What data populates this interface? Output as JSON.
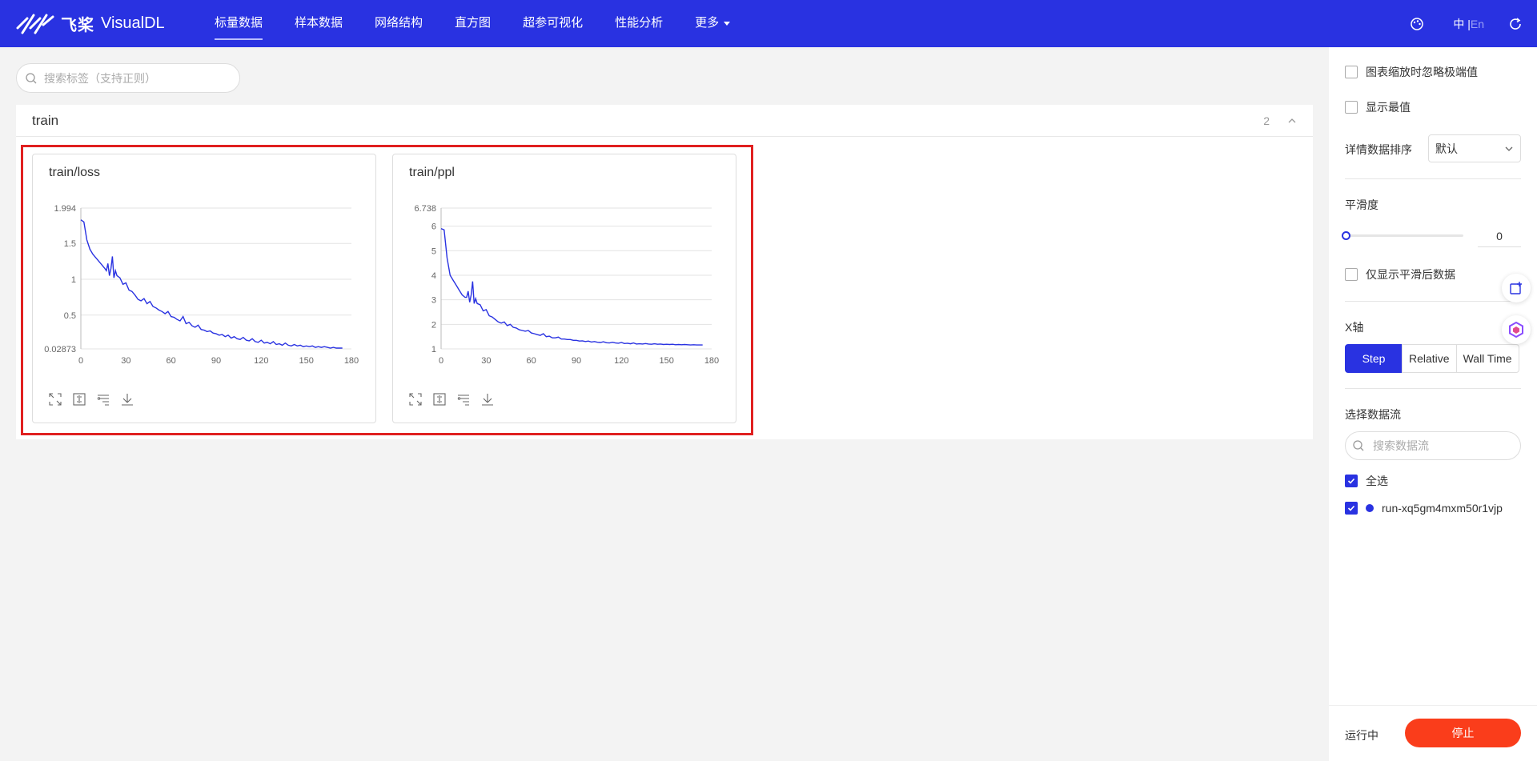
{
  "brand": {
    "cn": "飞桨",
    "en": "VisualDL"
  },
  "nav": {
    "items": [
      {
        "label": "标量数据"
      },
      {
        "label": "样本数据"
      },
      {
        "label": "网络结构"
      },
      {
        "label": "直方图"
      },
      {
        "label": "超参可视化"
      },
      {
        "label": "性能分析"
      },
      {
        "label": "更多"
      }
    ],
    "lang_cn": "中",
    "lang_sep": "|",
    "lang_en": "En"
  },
  "search": {
    "placeholder": "搜索标签（支持正则）"
  },
  "group": {
    "title": "train",
    "count": "2"
  },
  "cards": [
    {
      "title": "train/loss"
    },
    {
      "title": "train/ppl"
    }
  ],
  "chart_data": [
    {
      "type": "line",
      "title": "train/loss",
      "xlim": [
        0,
        180
      ],
      "ylim": [
        0.02873,
        1.994
      ],
      "xticks": [
        "0",
        "30",
        "60",
        "90",
        "120",
        "150",
        "180"
      ],
      "yticks": [
        "0.02873",
        "0.5",
        "1",
        "1.5",
        "1.994"
      ],
      "color": "#2932e1",
      "grid": true,
      "series": [
        {
          "x": [
            0,
            2,
            4,
            6,
            8,
            10,
            12,
            14,
            16,
            17,
            18,
            19,
            20,
            21,
            22,
            23,
            24,
            26,
            28,
            30,
            32,
            34,
            36,
            38,
            40,
            42,
            44,
            46,
            48,
            50,
            52,
            54,
            56,
            58,
            60,
            62,
            64,
            66,
            68,
            70,
            72,
            74,
            76,
            78,
            80,
            82,
            84,
            86,
            88,
            90,
            92,
            94,
            96,
            98,
            100,
            102,
            104,
            106,
            108,
            110,
            112,
            114,
            116,
            118,
            120,
            122,
            124,
            126,
            128,
            130,
            132,
            134,
            136,
            138,
            140,
            142,
            144,
            146,
            148,
            150,
            152,
            154,
            156,
            158,
            160,
            162,
            164,
            166,
            168,
            170,
            172,
            174
          ],
          "y": [
            1.83,
            1.8,
            1.55,
            1.42,
            1.35,
            1.3,
            1.25,
            1.2,
            1.15,
            1.12,
            1.22,
            1.05,
            1.15,
            1.32,
            1.02,
            1.12,
            1.05,
            1.02,
            0.93,
            0.95,
            0.85,
            0.83,
            0.78,
            0.72,
            0.7,
            0.73,
            0.66,
            0.69,
            0.62,
            0.6,
            0.57,
            0.55,
            0.52,
            0.55,
            0.48,
            0.47,
            0.44,
            0.42,
            0.48,
            0.38,
            0.4,
            0.35,
            0.33,
            0.36,
            0.3,
            0.29,
            0.27,
            0.28,
            0.25,
            0.24,
            0.22,
            0.23,
            0.2,
            0.22,
            0.18,
            0.2,
            0.17,
            0.16,
            0.19,
            0.15,
            0.14,
            0.17,
            0.13,
            0.12,
            0.15,
            0.11,
            0.12,
            0.1,
            0.13,
            0.09,
            0.1,
            0.08,
            0.11,
            0.08,
            0.07,
            0.09,
            0.07,
            0.08,
            0.06,
            0.07,
            0.06,
            0.07,
            0.05,
            0.06,
            0.05,
            0.06,
            0.05,
            0.04,
            0.05,
            0.04,
            0.04,
            0.04
          ]
        }
      ]
    },
    {
      "type": "line",
      "title": "train/ppl",
      "xlim": [
        0,
        180
      ],
      "ylim": [
        1,
        6.738
      ],
      "xticks": [
        "0",
        "30",
        "60",
        "90",
        "120",
        "150",
        "180"
      ],
      "yticks": [
        "1",
        "2",
        "3",
        "4",
        "5",
        "6",
        "6.738"
      ],
      "color": "#2932e1",
      "grid": true,
      "series": [
        {
          "x": [
            0,
            2,
            4,
            6,
            8,
            10,
            12,
            14,
            16,
            17,
            18,
            19,
            20,
            21,
            22,
            23,
            24,
            26,
            28,
            30,
            32,
            34,
            36,
            38,
            40,
            42,
            44,
            46,
            48,
            50,
            52,
            54,
            56,
            58,
            60,
            62,
            64,
            66,
            68,
            70,
            72,
            74,
            76,
            78,
            80,
            82,
            84,
            86,
            88,
            90,
            92,
            94,
            96,
            98,
            100,
            102,
            104,
            106,
            108,
            110,
            112,
            114,
            116,
            118,
            120,
            122,
            124,
            126,
            128,
            130,
            132,
            134,
            136,
            138,
            140,
            142,
            144,
            146,
            148,
            150,
            152,
            154,
            156,
            158,
            160,
            162,
            164,
            166,
            168,
            170,
            172,
            174
          ],
          "y": [
            5.9,
            5.85,
            4.7,
            4.0,
            3.8,
            3.6,
            3.4,
            3.2,
            3.1,
            3.1,
            3.35,
            2.9,
            3.2,
            3.75,
            2.85,
            3.05,
            2.85,
            2.8,
            2.55,
            2.6,
            2.35,
            2.3,
            2.2,
            2.1,
            2.05,
            2.1,
            1.95,
            2.0,
            1.88,
            1.85,
            1.78,
            1.75,
            1.72,
            1.75,
            1.65,
            1.62,
            1.58,
            1.55,
            1.62,
            1.5,
            1.52,
            1.45,
            1.45,
            1.48,
            1.4,
            1.4,
            1.38,
            1.38,
            1.35,
            1.35,
            1.32,
            1.33,
            1.3,
            1.32,
            1.28,
            1.3,
            1.27,
            1.26,
            1.29,
            1.25,
            1.24,
            1.27,
            1.24,
            1.23,
            1.26,
            1.22,
            1.23,
            1.21,
            1.24,
            1.2,
            1.21,
            1.2,
            1.22,
            1.2,
            1.19,
            1.21,
            1.19,
            1.2,
            1.18,
            1.19,
            1.18,
            1.19,
            1.17,
            1.18,
            1.17,
            1.18,
            1.17,
            1.16,
            1.17,
            1.16,
            1.16,
            1.16
          ]
        }
      ]
    }
  ],
  "panel": {
    "ignore_outliers": "图表缩放时忽略极端值",
    "show_extremes": "显示最值",
    "sort_label": "详情数据排序",
    "sort_value": "默认",
    "smoothing_label": "平滑度",
    "smoothing_value": "0",
    "only_smoothed": "仅显示平滑后数据",
    "xaxis_label": "X轴",
    "xaxis_options": [
      "Step",
      "Relative",
      "Wall Time"
    ],
    "run_label": "选择数据流",
    "run_search_placeholder": "搜索数据流",
    "select_all": "全选",
    "run_name": "run-xq5gm4mxm50r1vjp",
    "status": "运行中",
    "stop": "停止"
  }
}
